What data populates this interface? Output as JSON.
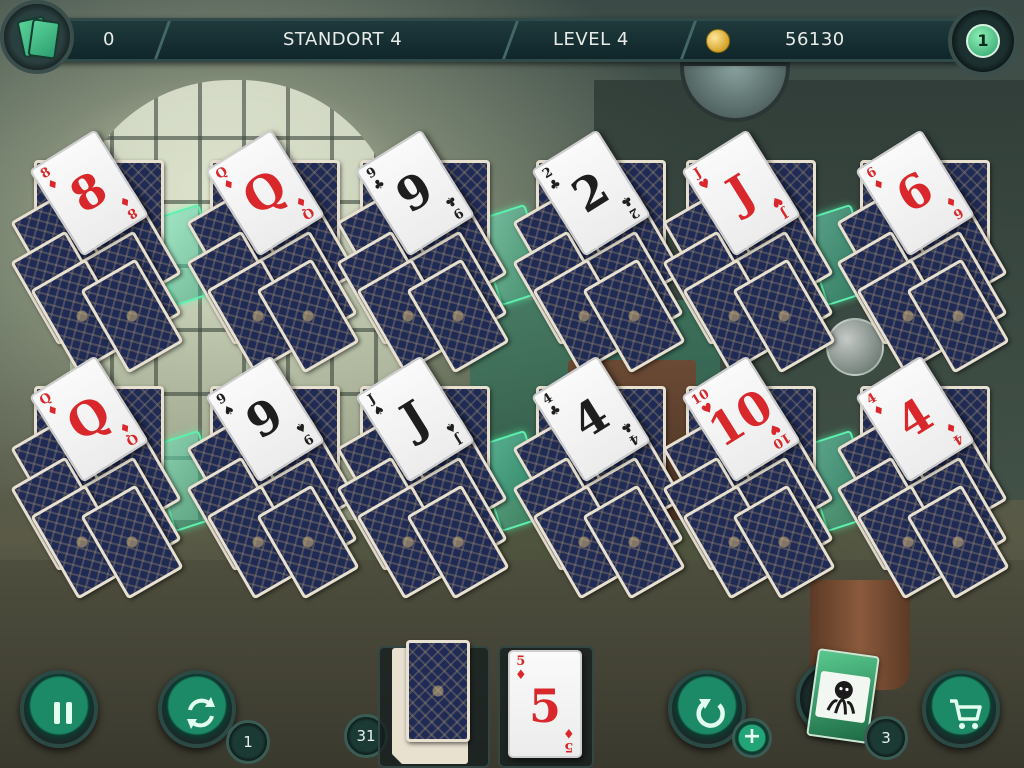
{
  "hud": {
    "moves": "0",
    "location": "STANDORT 4",
    "level": "LEVEL 4",
    "coins": "56130",
    "level_badge": "1"
  },
  "tableaus": [
    {
      "top": {
        "rank": "8",
        "suit": "♦",
        "color": "red"
      }
    },
    {
      "top": {
        "rank": "Q",
        "suit": "♦",
        "color": "red"
      }
    },
    {
      "top": {
        "rank": "9",
        "suit": "♣",
        "color": "black"
      }
    },
    {
      "top": {
        "rank": "2",
        "suit": "♣",
        "color": "black"
      }
    },
    {
      "top": {
        "rank": "J",
        "suit": "♥",
        "color": "red"
      }
    },
    {
      "top": {
        "rank": "6",
        "suit": "♦",
        "color": "red"
      }
    },
    {
      "top": {
        "rank": "Q",
        "suit": "♦",
        "color": "red"
      }
    },
    {
      "top": {
        "rank": "9",
        "suit": "♠",
        "color": "black"
      }
    },
    {
      "top": {
        "rank": "J",
        "suit": "♠",
        "color": "black"
      }
    },
    {
      "top": {
        "rank": "4",
        "suit": "♣",
        "color": "black"
      }
    },
    {
      "top": {
        "rank": "10",
        "suit": "♥",
        "color": "red"
      }
    },
    {
      "top": {
        "rank": "4",
        "suit": "♦",
        "color": "red"
      }
    }
  ],
  "stock": {
    "count": "31"
  },
  "waste": {
    "rank": "5",
    "suit": "♦",
    "color": "red"
  },
  "controls": {
    "shuffle_count": "1",
    "undo_plus": "+",
    "joker_count": "3"
  },
  "icons": [
    "cards-icon",
    "coin-icon",
    "pause-icon",
    "shuffle-icon",
    "undo-icon",
    "kraken-joker-icon",
    "cart-icon"
  ],
  "colors": {
    "accent": "#1d8a67",
    "hud_bg": "#10262a",
    "card_red": "#d9282b",
    "card_back": "#1f2b55"
  }
}
